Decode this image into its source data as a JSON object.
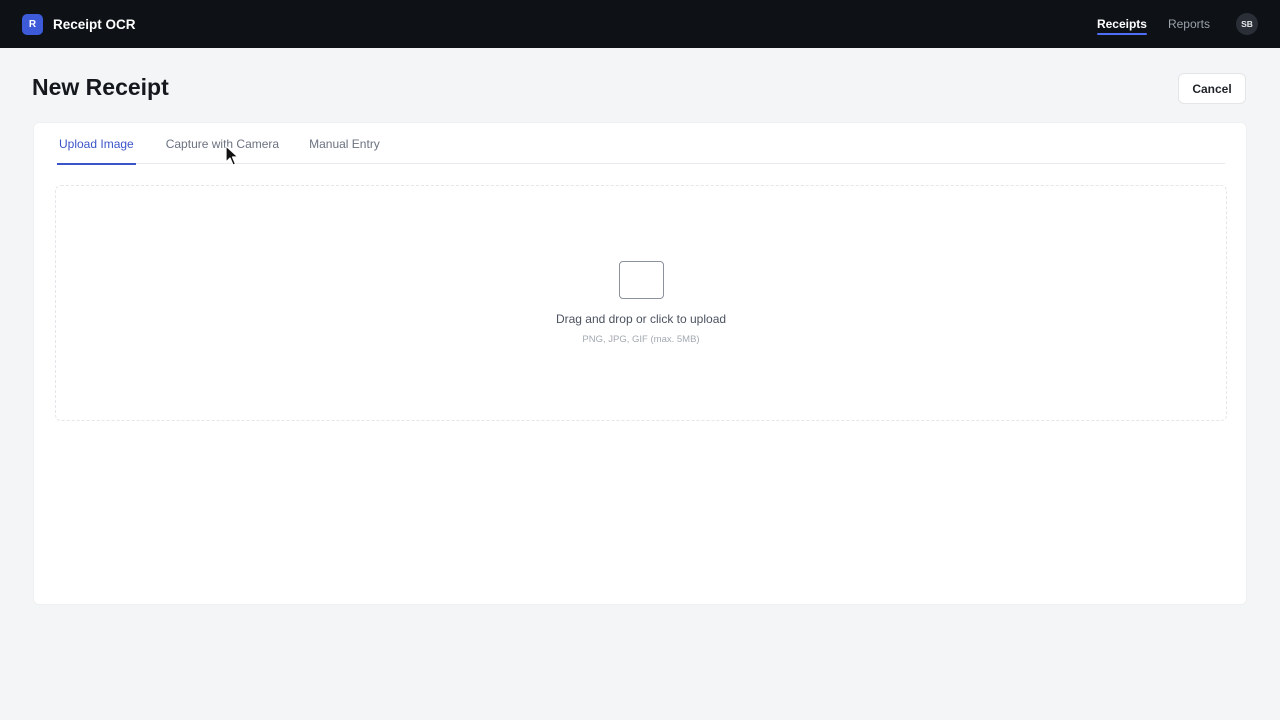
{
  "app": {
    "logo_letter": "R",
    "name": "Receipt OCR"
  },
  "nav": {
    "items": [
      {
        "label": "Receipts",
        "active": true
      },
      {
        "label": "Reports",
        "active": false
      }
    ],
    "user_initials": "SB"
  },
  "page": {
    "title": "New Receipt",
    "cancel_label": "Cancel"
  },
  "tabs": [
    {
      "label": "Upload Image",
      "active": true
    },
    {
      "label": "Capture with Camera",
      "active": false
    },
    {
      "label": "Manual Entry",
      "active": false
    }
  ],
  "upload": {
    "icon": "image-placeholder-icon",
    "prompt": "Drag and drop or click to upload",
    "hint": "PNG, JPG, GIF (max. 5MB)"
  },
  "colors": {
    "topbar_bg": "#0e1116",
    "accent": "#3b54c9",
    "logo_bg": "#3d5bd9",
    "page_bg": "#f4f5f7"
  }
}
